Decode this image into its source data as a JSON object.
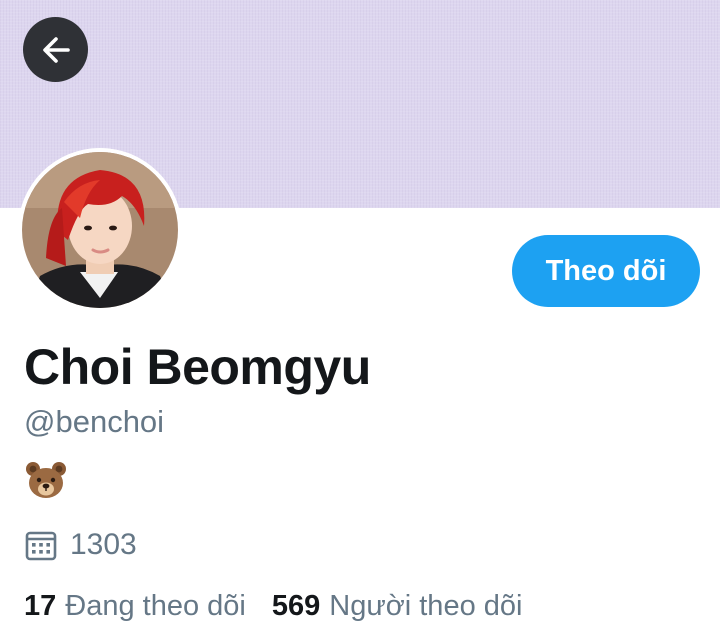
{
  "profile": {
    "display_name": "Choi Beomgyu",
    "handle": "@benchoi",
    "bio_emoji_icon": "bear-face-icon",
    "joined_value": "1303",
    "joined_icon": "calendar-icon",
    "banner_color": "#ddd6ef",
    "avatar_description_icon": "avatar"
  },
  "actions": {
    "back_icon": "arrow-left-icon",
    "follow_label": "Theo dõi",
    "follow_color": "#1da1f2"
  },
  "stats": {
    "following_count": "17",
    "following_label": "Đang theo dõi",
    "followers_count": "569",
    "followers_label": "Người theo dõi"
  }
}
